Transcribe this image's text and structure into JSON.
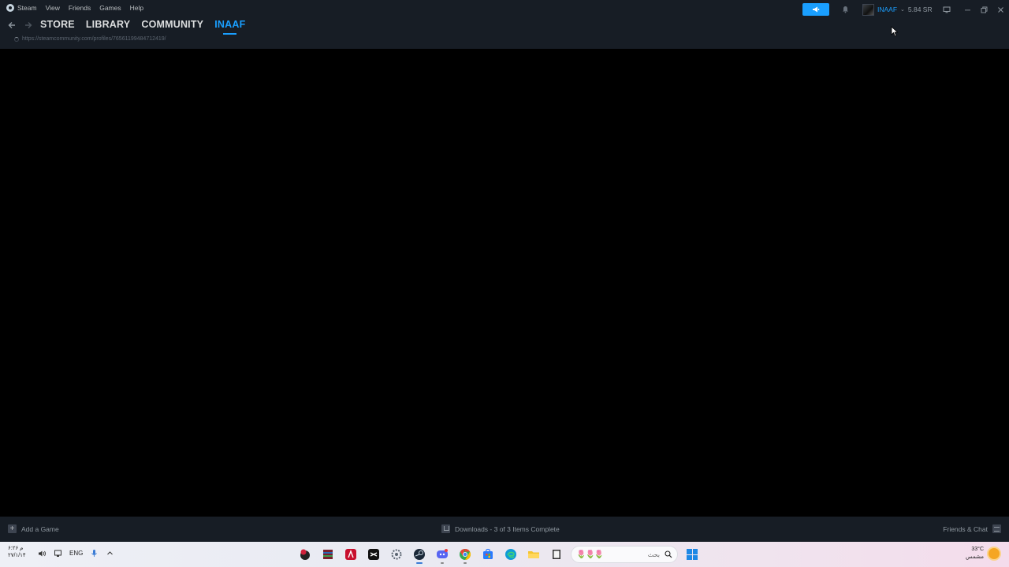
{
  "menu": {
    "items": [
      "Steam",
      "View",
      "Friends",
      "Games",
      "Help"
    ]
  },
  "titlebar": {
    "notify_icon": "megaphone-icon",
    "bell_icon": "bell-icon",
    "account_name": "INAAF",
    "account_caret": "⌄",
    "wallet": "5.84 SR"
  },
  "nav": {
    "tabs": [
      {
        "label": "STORE",
        "active": false
      },
      {
        "label": "LIBRARY",
        "active": false
      },
      {
        "label": "COMMUNITY",
        "active": false
      },
      {
        "label": "INAAF",
        "active": true
      }
    ],
    "url": "https://steamcommunity.com/profiles/76561199484712419/"
  },
  "bottombar": {
    "add_game": "Add a Game",
    "downloads": "Downloads - 3 of 3 Items Complete",
    "friends_chat": "Friends & Chat"
  },
  "taskbar": {
    "time": "۶:۲۶ م",
    "date": "۲۷/۱/۱۴",
    "language": "ENG",
    "search_placeholder": "بحث",
    "weather_temp": "33°C",
    "weather_desc": "مشمس",
    "apps": [
      {
        "name": "mixed-reality-app",
        "color": "#d0203a"
      },
      {
        "name": "winrar-app",
        "color": "#7a1f2b"
      },
      {
        "name": "acrobat-app",
        "color": "#c8102e"
      },
      {
        "name": "capcut-app",
        "color": "#111111"
      },
      {
        "name": "settings-app",
        "color": "#5a6470"
      },
      {
        "name": "steam-app",
        "color": "#1b2838"
      },
      {
        "name": "discord-app",
        "color": "#5865f2"
      },
      {
        "name": "chrome-app",
        "color": "#34a853"
      },
      {
        "name": "store-app",
        "color": "#2979ff"
      },
      {
        "name": "edge-app",
        "color": "#0f9bd7"
      },
      {
        "name": "file-explorer-app",
        "color": "#f4c430"
      },
      {
        "name": "terminal-app",
        "color": "#333333"
      }
    ]
  }
}
